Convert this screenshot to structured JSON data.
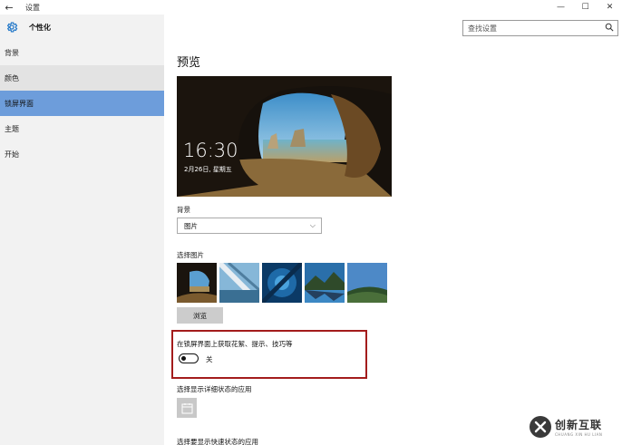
{
  "window": {
    "title": "设置",
    "back_glyph": "←",
    "minimize_glyph": "—",
    "maximize_glyph": "☐",
    "close_glyph": "✕"
  },
  "sidebar": {
    "header_icon": "gear-icon",
    "header_label": "个性化",
    "items": [
      {
        "label": "背景",
        "state": "normal"
      },
      {
        "label": "颜色",
        "state": "hover"
      },
      {
        "label": "锁屏界面",
        "state": "selected"
      },
      {
        "label": "主题",
        "state": "normal"
      },
      {
        "label": "开始",
        "state": "normal"
      }
    ]
  },
  "search": {
    "placeholder": "查找设置",
    "icon": "search-icon"
  },
  "main": {
    "title": "预览",
    "preview": {
      "time": "16:30",
      "date": "2月26日, 星期五"
    },
    "background_label": "背景",
    "background_value": "图片",
    "choose_picture_label": "选择图片",
    "thumbnails_count_note": null,
    "browse_label": "浏览",
    "tips_label": "在锁屏界面上获取花絮、提示、技巧等",
    "tips_toggle_state": "关",
    "tips_toggle_on": false,
    "detail_app_label": "选择显示详细状态的应用",
    "quick_app_label": "选择要显示快速状态的应用"
  },
  "colors": {
    "accent": "#6d9ddb",
    "sidebar_bg": "#f2f2f2",
    "highlight_border": "#a31c1c"
  },
  "watermark": {
    "brand": "创新互联",
    "sub": "CHUANG XIN HU LIAN"
  }
}
